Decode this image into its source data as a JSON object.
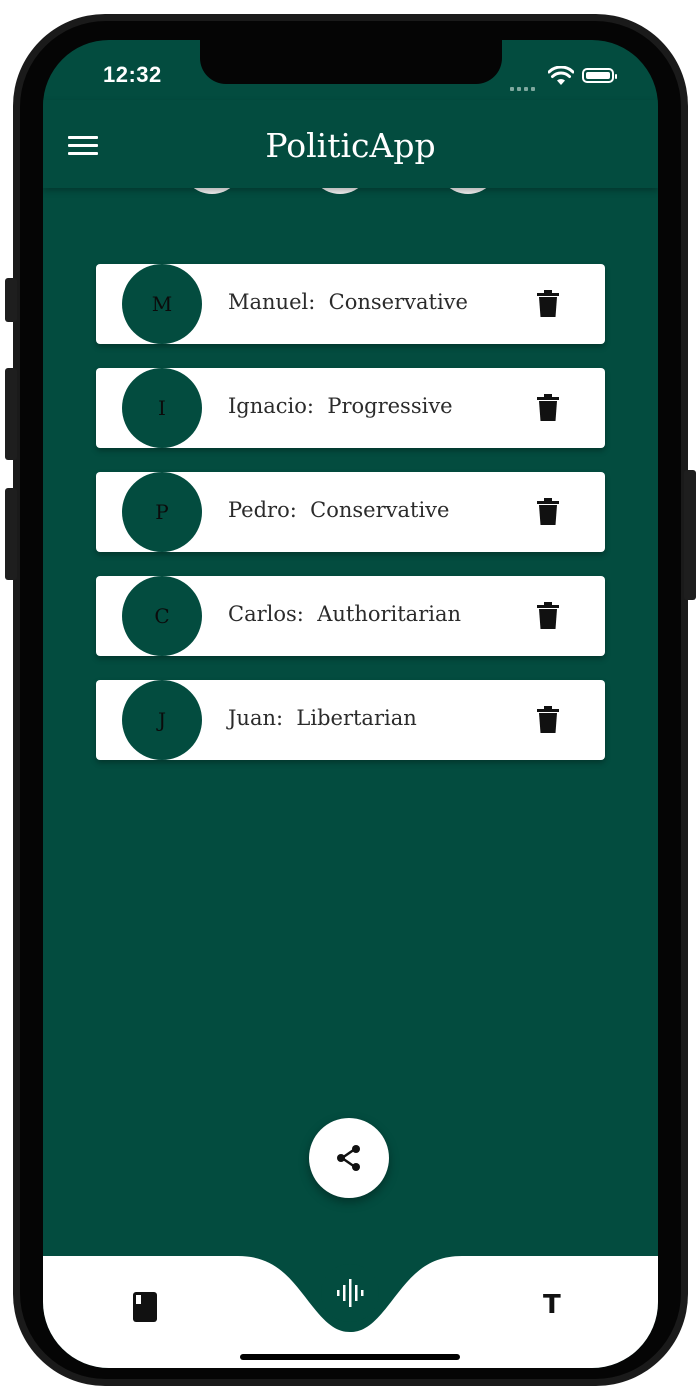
{
  "status_bar": {
    "time": "12:32"
  },
  "app_bar": {
    "title": "PoliticApp"
  },
  "people": [
    {
      "initial": "M",
      "label": "Manuel:  Conservative"
    },
    {
      "initial": "I",
      "label": "Ignacio:  Progressive"
    },
    {
      "initial": "P",
      "label": "Pedro:  Conservative"
    },
    {
      "initial": "C",
      "label": "Carlos:  Authoritarian"
    },
    {
      "initial": "J",
      "label": "Juan:  Libertarian"
    }
  ],
  "bottom_nav": {
    "text_label": "T"
  },
  "colors": {
    "primary": "#034c3f",
    "surface": "#ffffff",
    "icon": "#111111"
  },
  "icons": {
    "menu": "hamburger-icon",
    "delete": "trash-icon",
    "share": "share-icon",
    "book": "book-icon",
    "audio": "audio-wave-icon",
    "text": "text-format-icon"
  }
}
